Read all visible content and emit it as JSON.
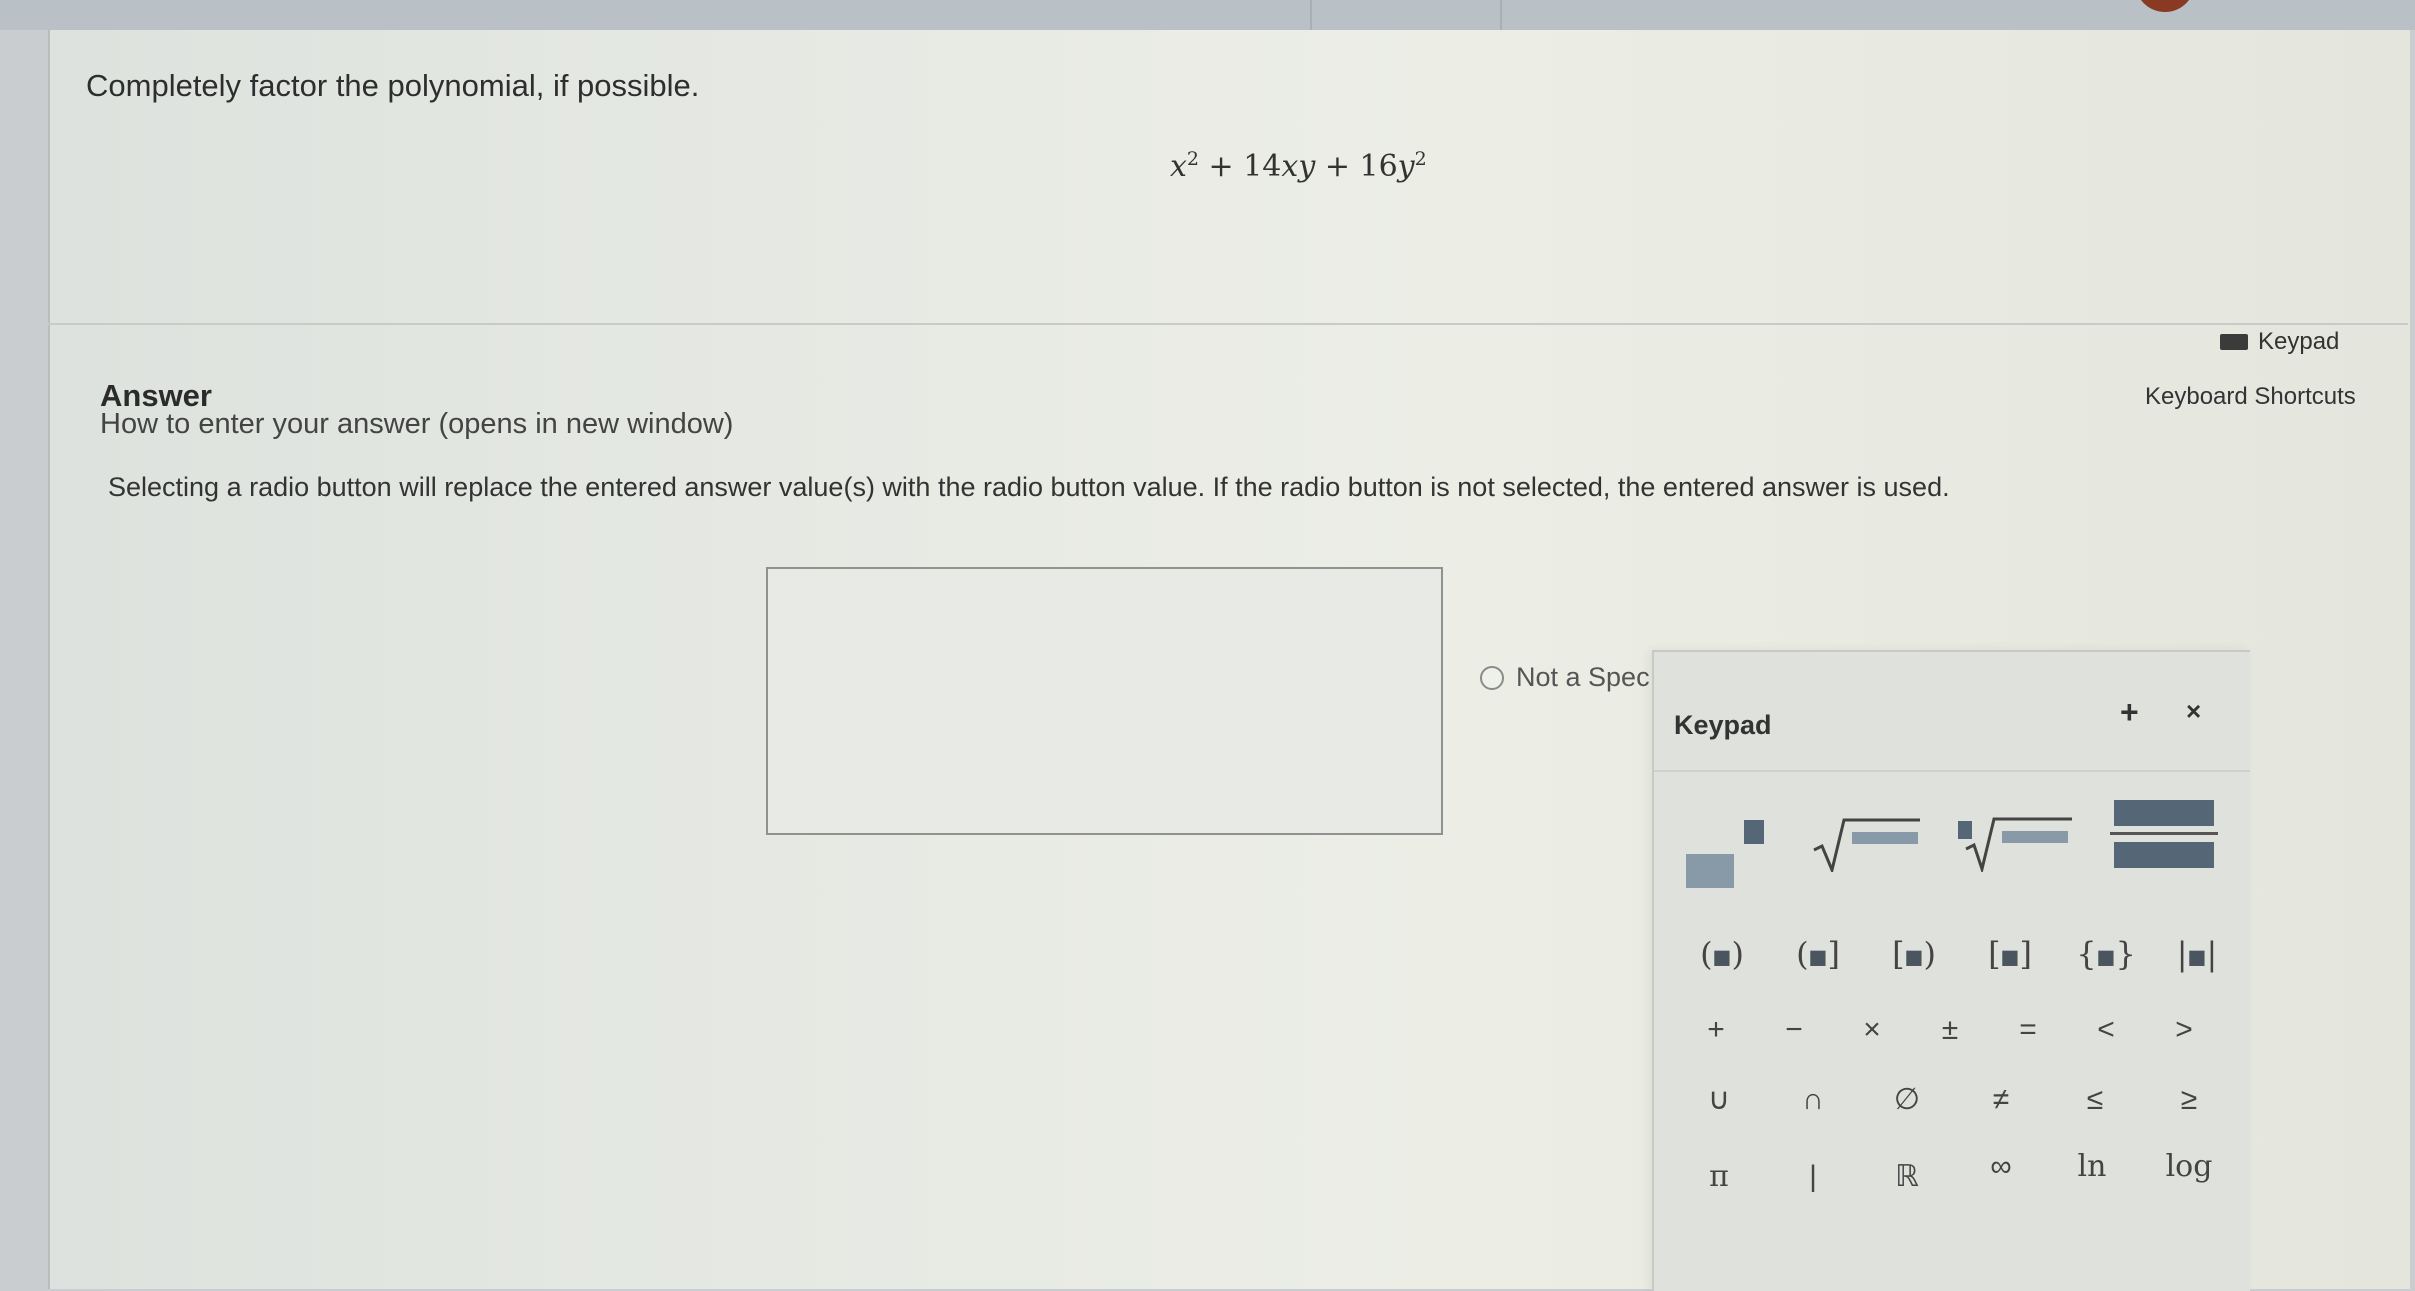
{
  "question": {
    "prompt": "Completely factor the polynomial, if possible.",
    "expr": {
      "t1_var": "x",
      "t1_exp": "2",
      "op1": " + 14",
      "t2_var": "xy",
      "op2": " + 16",
      "t3_var": "y",
      "t3_exp": "2"
    }
  },
  "answer_section": {
    "label": "Answer",
    "help_link": "How to enter your answer (opens in new window)",
    "keypad_toggle": "Keypad",
    "shortcuts_link": "Keyboard Shortcuts",
    "instruction": "Selecting a radio button will replace the entered answer value(s) with the radio button value. If the radio button is not selected, the entered answer is used.",
    "answer_value": "",
    "radio_label": "Not a Spec"
  },
  "keypad": {
    "title": "Keypad",
    "move_icon": "+",
    "close_icon": "×",
    "template_icons": [
      "exponent-template",
      "square-root-template",
      "nth-root-template",
      "fraction-template"
    ],
    "brackets": [
      {
        "open": "(",
        "close": ")"
      },
      {
        "open": "(",
        "close": "]"
      },
      {
        "open": "[",
        "close": ")"
      },
      {
        "open": "[",
        "close": "]"
      },
      {
        "open": "{",
        "close": "}"
      },
      {
        "open": "|",
        "close": "|"
      }
    ],
    "row_ops": [
      "+",
      "−",
      "×",
      "±",
      "=",
      "<",
      ">"
    ],
    "row_sets": [
      "∪",
      "∩",
      "∅",
      "≠",
      "≤",
      "≥"
    ],
    "row_consts": [
      "π",
      "|",
      "ℝ",
      "∞",
      "ln",
      "log"
    ],
    "slot_glyph": "■"
  },
  "colors": {
    "page_bg": "#e6e9e3",
    "slot_dark": "#556777",
    "slot_light": "#8899a8"
  }
}
